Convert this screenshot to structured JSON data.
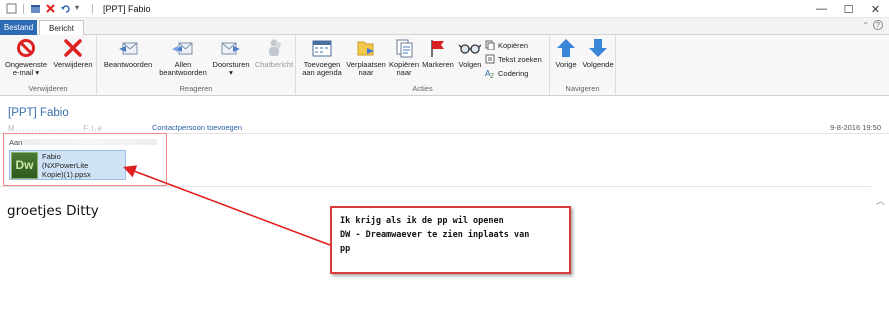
{
  "window": {
    "title": "[PPT] Fabio",
    "controls": {
      "minimize": "—",
      "maximize": "☐",
      "close": "✕"
    }
  },
  "tabs": {
    "file": "Bestand",
    "message": "Bericht"
  },
  "ribbon": {
    "groups": {
      "delete": {
        "label": "Verwijderen",
        "junk_line1": "Ongewenste",
        "junk_line2": "e-mail ▾",
        "delete": "Verwijderen"
      },
      "respond": {
        "label": "Reageren",
        "reply": "Beantwoorden",
        "reply_all_line1": "Allen",
        "reply_all_line2": "beantwoorden",
        "forward": "Doorsturen",
        "forward_arrow": "▾",
        "chat": "Chatbericht"
      },
      "actions": {
        "label": "Acties",
        "add_cal_line1": "Toevoegen",
        "add_cal_line2": "aan agenda",
        "move_line1": "Verplaatsen",
        "move_line2": "naar",
        "copy_line1": "Kopiëren",
        "copy_line2": "naar",
        "mark": "Markeren",
        "follow": "Volgen",
        "copy_small": "Kopiëren",
        "find_text": "Tekst zoeken",
        "encoding": "Codering"
      },
      "navigate": {
        "label": "Navigeren",
        "prev": "Vorige",
        "next": "Volgende"
      }
    }
  },
  "message": {
    "subject": "[PPT] Fabio",
    "sender": "M.........  ..........  F.l.e",
    "add_contact": "Contactpersoon toevoegen",
    "date": "9-8-2016 19:50",
    "to_label": "Aan:",
    "attachment": {
      "icon_text": "Dw",
      "name_line1": "Fabio",
      "name_line2": "(NXPowerLite",
      "name_line3": "Kopie)(1).ppsx"
    },
    "body": "groetjes Ditty"
  },
  "annotation": {
    "text": "Ik krijg als ik de pp wil openen\nDW - Dreamwaever te zien inplaats van\npp"
  },
  "colors": {
    "accent_blue": "#2e6ab3",
    "link_blue": "#2a5fa8",
    "annotation_red": "#d93a3a",
    "attachment_bg": "#cfe3f6"
  }
}
